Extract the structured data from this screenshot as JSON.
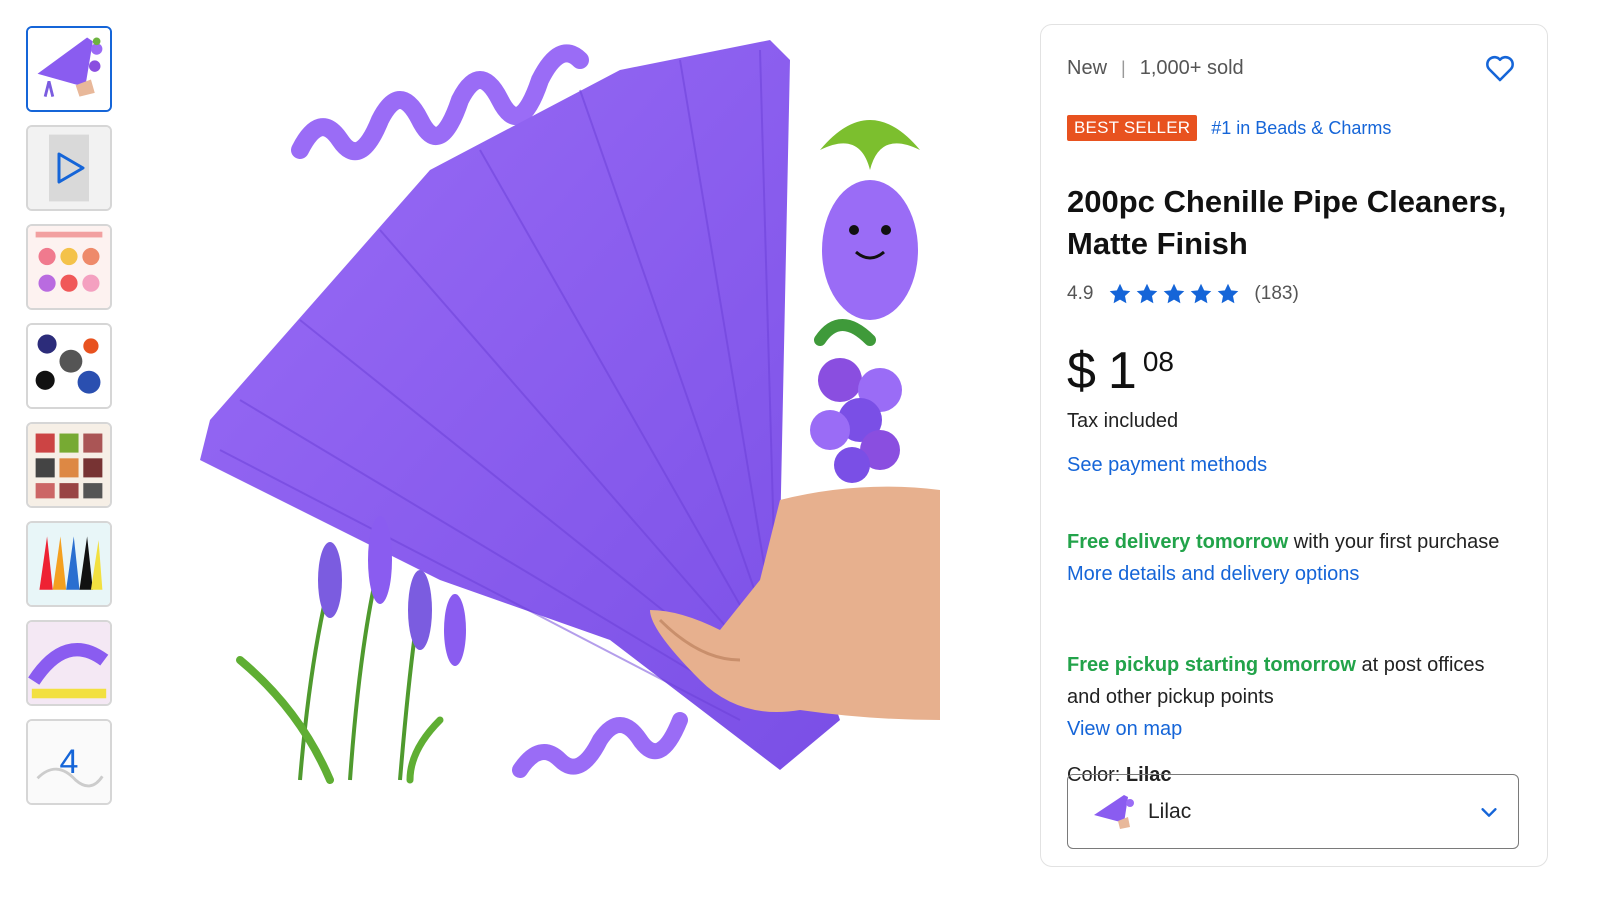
{
  "gallery": {
    "thumbnails": [
      {
        "kind": "image",
        "selected": true
      },
      {
        "kind": "video"
      },
      {
        "kind": "image"
      },
      {
        "kind": "image"
      },
      {
        "kind": "image"
      },
      {
        "kind": "image"
      },
      {
        "kind": "image"
      },
      {
        "kind": "more",
        "label": "4"
      }
    ]
  },
  "product": {
    "condition": "New",
    "sold": "1,000+ sold",
    "badge": "BEST SELLER",
    "rank": "#1 in Beads & Charms",
    "title": "200pc Chenille Pipe Cleaners, Matte Finish",
    "rating": "4.9",
    "star_count": 5,
    "reviews": "(183)",
    "price_currency": "$",
    "price_whole": "1",
    "price_cents": "08",
    "tax_note": "Tax included",
    "payment_link": "See payment methods"
  },
  "delivery": {
    "highlight": "Free delivery tomorrow",
    "text": " with your first purchase",
    "link": "More details and delivery options"
  },
  "pickup": {
    "highlight": "Free pickup starting tomorrow",
    "text": " at post offices and other pickup points",
    "link": "View on map"
  },
  "color": {
    "label": "Color:",
    "selected": "Lilac",
    "option": "Lilac"
  },
  "colors": {
    "accent_link": "#1565d8",
    "badge": "#e8521f",
    "green": "#22a34a",
    "product_purple": "#8a5cf0"
  },
  "icons": {
    "wishlist": "heart-outline-icon",
    "star": "star-icon",
    "dropdown": "chevron-down-icon",
    "video": "play-icon"
  }
}
